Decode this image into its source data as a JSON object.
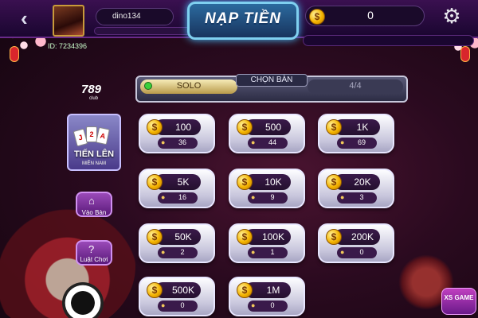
{
  "header": {
    "back_icon": "chevron-left-icon",
    "user_id_label": "ID: 7234396",
    "username": "dino134",
    "title": "NẠP TIỀN",
    "coin_symbol": "$",
    "balance": "0",
    "settings_icon": "gear-icon"
  },
  "sidebar": {
    "logo_number": "789",
    "logo_club": "club",
    "game_name": "TIẾN LÊN",
    "game_sub": "MIỀN NAM",
    "enter_label": "Vào Bàn",
    "rules_label": "Luật Chơi",
    "rules_icon": "?"
  },
  "mode": {
    "solo": "SOLO",
    "choose_table": "CHỌN BÀN",
    "players": "4/4"
  },
  "tiles": [
    {
      "amount": "100",
      "players": "36"
    },
    {
      "amount": "500",
      "players": "44"
    },
    {
      "amount": "1K",
      "players": "69"
    },
    {
      "amount": "5K",
      "players": "16"
    },
    {
      "amount": "10K",
      "players": "9"
    },
    {
      "amount": "20K",
      "players": "3"
    },
    {
      "amount": "50K",
      "players": "2"
    },
    {
      "amount": "100K",
      "players": "1"
    },
    {
      "amount": "200K",
      "players": "0"
    },
    {
      "amount": "500K",
      "players": "0"
    },
    {
      "amount": "1M",
      "players": "0"
    }
  ],
  "corner_logo": "XS GAME",
  "colors": {
    "accent_gold": "#f4b400",
    "title_blue": "#2b6a9e",
    "bg_dark": "#2a0a1f"
  }
}
